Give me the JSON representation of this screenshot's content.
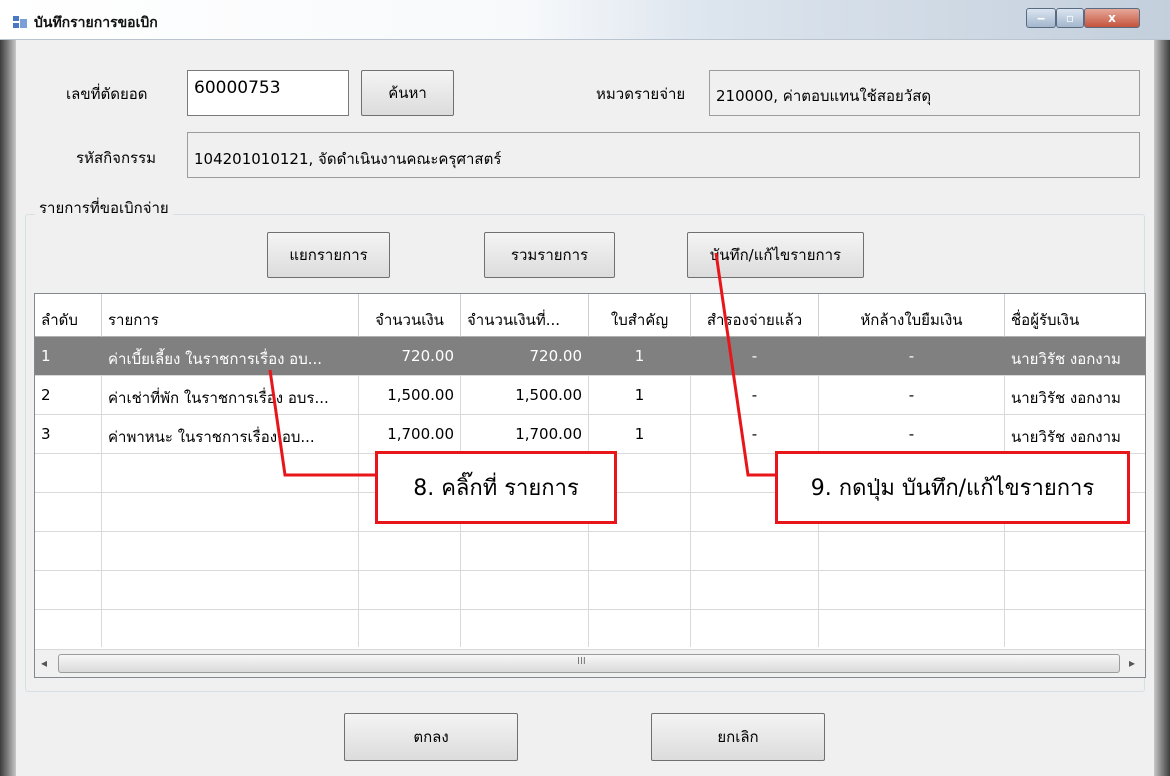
{
  "window": {
    "title": "บันทึกรายการขอเบิก",
    "min_glyph": "‒",
    "max_glyph": "▫",
    "close_glyph": "x"
  },
  "header": {
    "doc_no_label": "เลขที่ตัดยอด",
    "doc_no_value": "60000753",
    "search_label": "ค้นหา",
    "category_label": "หมวดรายจ่าย",
    "category_value": "210000, ค่าตอบแทนใช้สอยวัสดุ",
    "activity_label": "รหัสกิจกรรม",
    "activity_value": "104201010121, จัดดำเนินงานคณะครุศาสตร์"
  },
  "group": {
    "title": "รายการที่ขอเบิกจ่าย",
    "split_label": "แยกรายการ",
    "merge_label": "รวมรายการ",
    "save_edit_label": "บันทึก/แก้ไขรายการ"
  },
  "grid": {
    "columns": [
      "ลำดับ",
      "รายการ",
      "จำนวนเงิน",
      "จำนวนเงินที่...",
      "ใบสำคัญ",
      "สำรองจ่ายแล้ว",
      "หักล้างใบยืมเงิน",
      "ชื่อผู้รับเงิน"
    ],
    "rows": [
      {
        "no": "1",
        "item": "ค่าเบี้ยเลี้ยง ในราชการเรื่อง อบ...",
        "amount": "720.00",
        "amount2": "720.00",
        "voucher": "1",
        "advance": "-",
        "clear": "-",
        "payee": "นายวิรัช งอกงาม",
        "selected": true
      },
      {
        "no": "2",
        "item": "ค่าเช่าที่พัก ในราชการเรื่อง อบร...",
        "amount": "1,500.00",
        "amount2": "1,500.00",
        "voucher": "1",
        "advance": "-",
        "clear": "-",
        "payee": "นายวิรัช งอกงาม",
        "selected": false
      },
      {
        "no": "3",
        "item": "ค่าพาหนะ ในราชการเรื่อง อบ...",
        "amount": "1,700.00",
        "amount2": "1,700.00",
        "voucher": "1",
        "advance": "-",
        "clear": "-",
        "payee": "นายวิรัช งอกงาม",
        "selected": false
      }
    ],
    "scroll_left": "◂",
    "scroll_right": "▸",
    "scroll_grip": "III"
  },
  "footer": {
    "ok_label": "ตกลง",
    "cancel_label": "ยกเลิก"
  },
  "annotations": {
    "step8": "8. คลิ๊กที่ รายการ",
    "step9": "9. กดปุ่ม บันทึก/แก้ไขรายการ",
    "color": "#e8151a"
  },
  "colors": {
    "selected_row": "#808080",
    "client_bg": "#f0f0f0"
  }
}
